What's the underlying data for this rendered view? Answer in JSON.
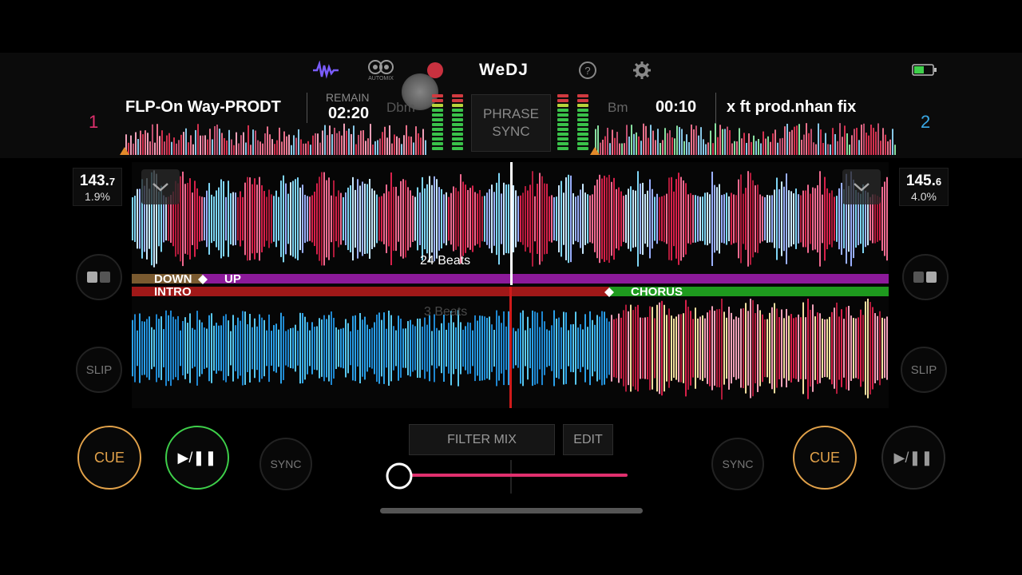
{
  "header": {
    "logo": "WeDJ",
    "automix_label": "AUTOMIX",
    "icons": [
      "waveform-icon",
      "automix-icon",
      "record-icon",
      "help-icon",
      "settings-icon",
      "battery-icon"
    ]
  },
  "deck1": {
    "number": "1",
    "title": "FLP-On Way-PRODT",
    "remain_label": "REMAIN",
    "time": "02:20",
    "key": "Dbm",
    "bpm_main": "143.",
    "bpm_decimal": "7",
    "pitch": "1.9%",
    "beats_label": "24 Beats",
    "cue_label": "CUE",
    "play_label": "▶/❚❚",
    "sync_label": "SYNC",
    "slip_label": "SLIP",
    "color": "#e0306e"
  },
  "deck2": {
    "number": "2",
    "title": "x ft prod.nhan fix",
    "time": "00:10",
    "key": "Bm",
    "bpm_main": "145.",
    "bpm_decimal": "6",
    "pitch": "4.0%",
    "beats_label": "3 Beats",
    "cue_label": "CUE",
    "play_label": "▶/❚❚",
    "sync_label": "SYNC",
    "slip_label": "SLIP",
    "color": "#3aa9e6"
  },
  "phrase_sync": {
    "line1": "PHRASE",
    "line2": "SYNC"
  },
  "phrases_deck1": [
    {
      "label": "DOWN",
      "color": "#7a5a30"
    },
    {
      "label": "UP",
      "color": "#8c1a9a"
    }
  ],
  "phrases_deck2": [
    {
      "label": "INTRO",
      "color": "#a01818"
    },
    {
      "label": "CHORUS",
      "color": "#1e9a1e"
    }
  ],
  "mixer": {
    "filter_mix_label": "FILTER MIX",
    "edit_label": "EDIT",
    "crossfader_value": 0.0,
    "accent": "#e0306e"
  }
}
